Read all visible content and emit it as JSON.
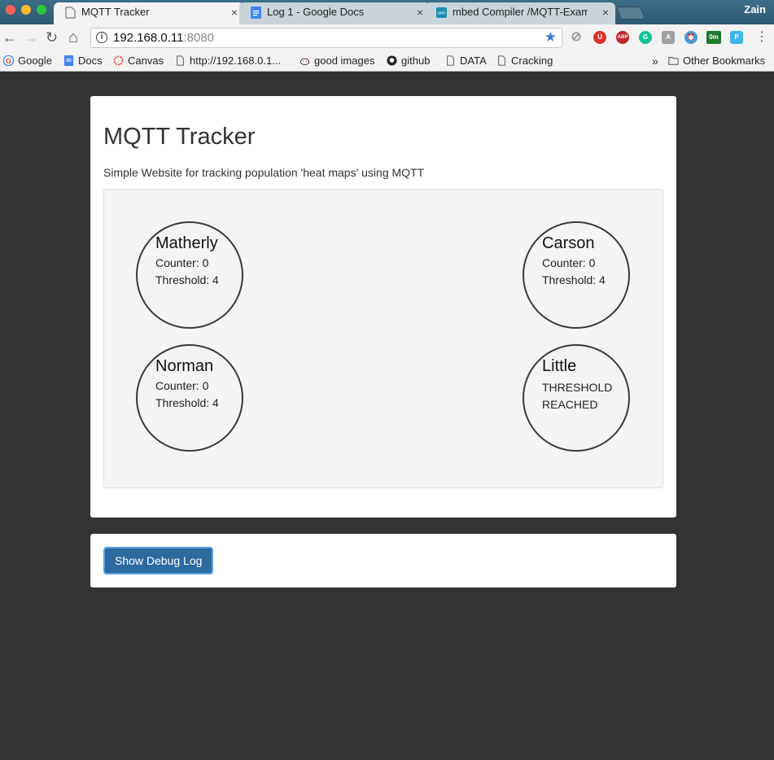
{
  "browser": {
    "profile_name": "Zain",
    "tabs": [
      {
        "title": "MQTT Tracker",
        "close": "×"
      },
      {
        "title": "Log 1 - Google Docs",
        "close": "×"
      },
      {
        "title": "mbed Compiler /MQTT-Exampl",
        "close": "×"
      }
    ],
    "nav": {
      "back": "←",
      "forward": "→",
      "reload": "↻",
      "home": "⌂"
    },
    "url": {
      "info": "i",
      "host": "192.168.0.11",
      "port": ":8080",
      "star": "★"
    },
    "extensions": [
      {
        "name": "block-icon",
        "label": "⊘",
        "color": "#9a9a9a"
      },
      {
        "name": "ublock-icon",
        "label": "U",
        "color": "#d9342b"
      },
      {
        "name": "abp-icon",
        "label": "ABP",
        "color": "#c0282d"
      },
      {
        "name": "grammarly-icon",
        "label": "G",
        "color": "#15c39a"
      },
      {
        "name": "extension-icon",
        "label": "A",
        "color": "#a0a0a0"
      },
      {
        "name": "clock-icon",
        "label": "⏰",
        "color": "#4a9bd4"
      },
      {
        "name": "timer-icon",
        "label": "0m",
        "color": "#1f7a2e"
      },
      {
        "name": "pocket-icon",
        "label": "P",
        "color": "#3fb4e8"
      }
    ],
    "menu": "⋮",
    "bookmarks": [
      {
        "label": "Google",
        "icon": "google-icon"
      },
      {
        "label": "Docs",
        "icon": "docs-icon"
      },
      {
        "label": "Canvas",
        "icon": "canvas-icon"
      },
      {
        "label": "http://192.168.0.1...",
        "icon": "page-icon"
      },
      {
        "label": "good images",
        "icon": "reddit-icon"
      },
      {
        "label": "github",
        "icon": "github-icon"
      },
      {
        "label": "DATA",
        "icon": "page-icon"
      },
      {
        "label": "Cracking",
        "icon": "page-icon"
      }
    ],
    "bookmarks_overflow": "»",
    "other_bookmarks": "Other Bookmarks"
  },
  "page": {
    "title": "MQTT Tracker",
    "subtitle": "Simple Website for tracking population 'heat maps' using MQTT",
    "zones": [
      {
        "name": "Matherly",
        "line1": "Counter: 0",
        "line2": "Threshold: 4"
      },
      {
        "name": "Carson",
        "line1": "Counter: 0",
        "line2": "Threshold: 4"
      },
      {
        "name": "Norman",
        "line1": "Counter: 0",
        "line2": "Threshold: 4"
      },
      {
        "name": "Little",
        "alert": "THRESHOLD REACHED"
      }
    ],
    "debug_button": "Show Debug Log"
  }
}
